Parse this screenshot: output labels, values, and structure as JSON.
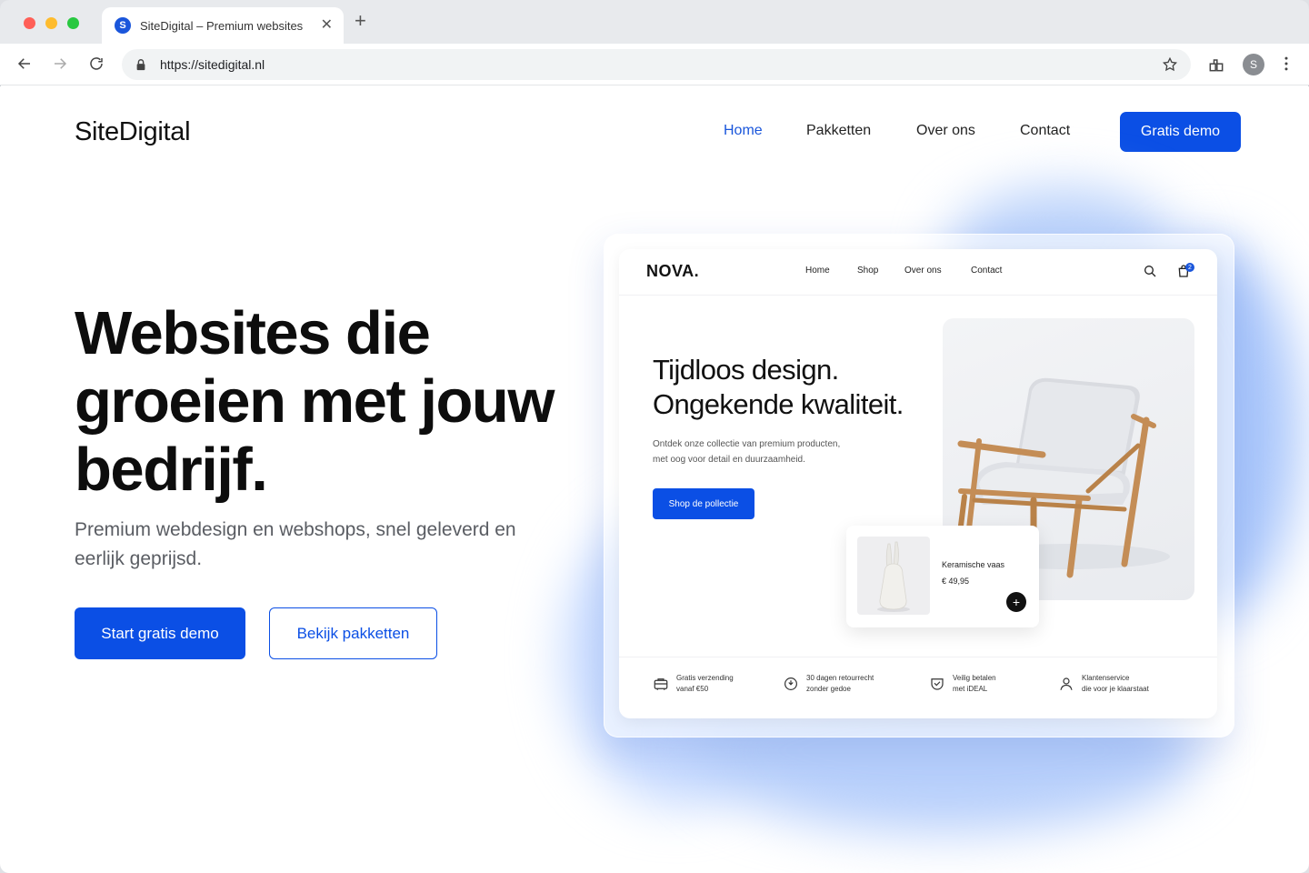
{
  "browser": {
    "tab_title": "SiteDigital – Premium websites",
    "tab_favicon_letter": "S",
    "url": "https://sitedigital.nl",
    "profile_letter": "S"
  },
  "site": {
    "brand": "SiteDigital",
    "nav": [
      {
        "label": "Home",
        "active": true
      },
      {
        "label": "Pakketten",
        "active": false
      },
      {
        "label": "Over ons",
        "active": false
      },
      {
        "label": "Contact",
        "active": false
      }
    ],
    "cta_top": "Gratis demo",
    "hero": {
      "title_line1": "Websites die",
      "title_line2": "groeien met jouw",
      "title_line3": "bedrijf.",
      "subtitle": "Premium webdesign en webshops, snel geleverd en eerlijk geprijsd.",
      "primary_button": "Start gratis demo",
      "secondary_button": "Bekijk pakketten"
    },
    "accent_color": "#0b4fe5"
  },
  "mockup": {
    "logo": "NOVA.",
    "nav": [
      "Home",
      "Shop",
      "Over ons",
      "Contact"
    ],
    "cart_count": "2",
    "title_line1": "Tijdloos design.",
    "title_line2": "Ongekende kwaliteit.",
    "subtitle_line1": "Ontdek onze collectie van premium producten,",
    "subtitle_line2": "met oog voor detail en duurzaamheid.",
    "button": "Shop de pollectie",
    "product": {
      "name": "Keramische vaas",
      "price": "€ 49,95",
      "add_label": "+"
    },
    "features": [
      {
        "icon": "delivery-icon",
        "line1": "Gratis verzending",
        "line2": "vanaf €50"
      },
      {
        "icon": "return-icon",
        "line1": "30 dagen retourrecht",
        "line2": "zonder gedoe"
      },
      {
        "icon": "shield-check-icon",
        "line1": "Veilig betalen",
        "line2": "met iDEAL"
      },
      {
        "icon": "user-icon",
        "line1": "Klantenservice",
        "line2": "die voor je klaarstaat"
      }
    ]
  }
}
